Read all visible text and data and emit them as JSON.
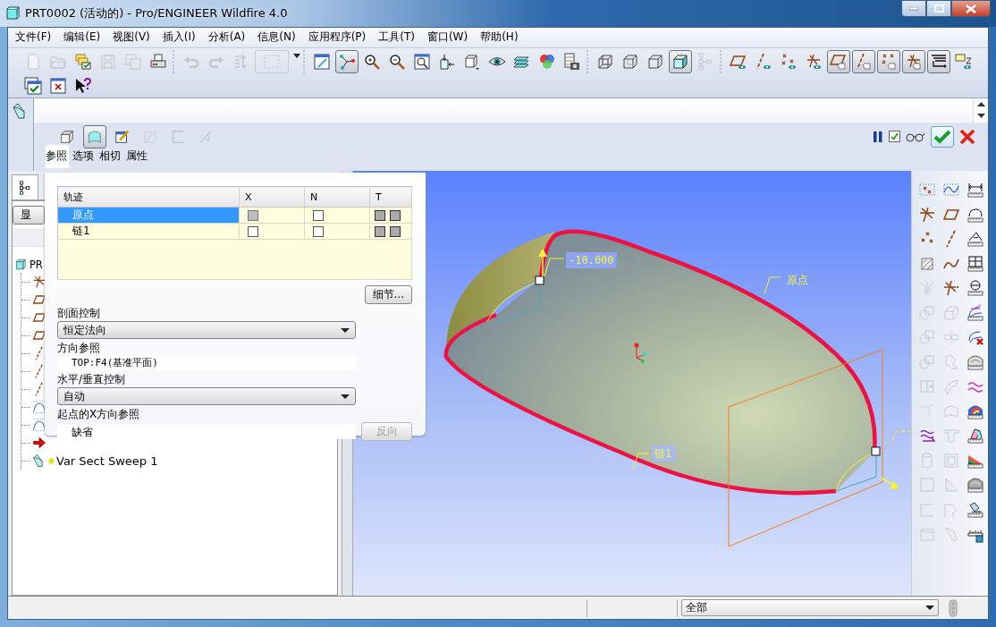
{
  "window": {
    "title": "PRT0002 (活动的) - Pro/ENGINEER Wildfire 4.0"
  },
  "menu": [
    "文件(F)",
    "编辑(E)",
    "视图(V)",
    "插入(I)",
    "分析(A)",
    "信息(N)",
    "应用程序(P)",
    "工具(T)",
    "窗口(W)",
    "帮助(H)"
  ],
  "toolbar_rows": [
    [
      [
        {
          "kind": "new",
          "pressed": false,
          "disabled": true
        },
        {
          "kind": "open",
          "pressed": false,
          "disabled": true
        },
        {
          "kind": "folders",
          "pressed": false,
          "disabled": false
        },
        {
          "kind": "save",
          "pressed": false,
          "disabled": true
        },
        {
          "kind": "savecopy",
          "pressed": false,
          "disabled": true
        },
        {
          "kind": "print",
          "pressed": false,
          "disabled": false
        }
      ],
      [
        {
          "kind": "undo",
          "pressed": false,
          "disabled": true
        },
        {
          "kind": "redo",
          "pressed": false,
          "disabled": true
        },
        {
          "kind": "regen",
          "pressed": false,
          "disabled": true
        },
        {
          "kind": "selectbox",
          "pressed": false,
          "disabled": true
        }
      ],
      [
        {
          "kind": "repaint",
          "pressed": false,
          "disabled": false
        },
        {
          "kind": "spin",
          "pressed": true,
          "disabled": false
        },
        {
          "kind": "zoomin",
          "pressed": false,
          "disabled": false
        },
        {
          "kind": "zoomout",
          "pressed": false,
          "disabled": false
        },
        {
          "kind": "refit",
          "pressed": false,
          "disabled": false
        },
        {
          "kind": "orient",
          "pressed": false,
          "disabled": false
        },
        {
          "kind": "views",
          "pressed": false,
          "disabled": false
        },
        {
          "kind": "display",
          "pressed": false,
          "disabled": false
        },
        {
          "kind": "layers",
          "pressed": false,
          "disabled": false
        },
        {
          "kind": "colors",
          "pressed": false,
          "disabled": false
        },
        {
          "kind": "camera",
          "pressed": false,
          "disabled": false
        }
      ],
      [
        {
          "kind": "wire",
          "pressed": false,
          "disabled": false
        },
        {
          "kind": "hidden",
          "pressed": false,
          "disabled": false
        },
        {
          "kind": "nohidden",
          "pressed": false,
          "disabled": false
        },
        {
          "kind": "shade",
          "pressed": true,
          "disabled": false
        },
        {
          "kind": "tree",
          "pressed": false,
          "disabled": true
        }
      ],
      [
        {
          "kind": "plane-eye",
          "pressed": false,
          "disabled": false
        },
        {
          "kind": "axis-eye",
          "pressed": false,
          "disabled": false
        },
        {
          "kind": "points-eye",
          "pressed": false,
          "disabled": false
        },
        {
          "kind": "csys-eye",
          "pressed": false,
          "disabled": false
        },
        {
          "kind": "plane-tag",
          "pressed": true,
          "disabled": false
        },
        {
          "kind": "axis-tag",
          "pressed": true,
          "disabled": false
        },
        {
          "kind": "points-tag",
          "pressed": true,
          "disabled": false
        },
        {
          "kind": "csys-tag",
          "pressed": true,
          "disabled": false
        },
        {
          "kind": "annotation",
          "pressed": true,
          "disabled": false
        },
        {
          "kind": "spin-eye",
          "pressed": false,
          "disabled": false
        }
      ]
    ],
    [
      [
        {
          "kind": "winok",
          "pressed": false,
          "disabled": false
        },
        {
          "kind": "winx",
          "pressed": false,
          "disabled": false
        },
        {
          "kind": "whatsthis",
          "pressed": false,
          "disabled": false
        }
      ]
    ]
  ],
  "dashboard": {
    "feature_types": [
      {
        "kind": "solid",
        "pressed": false,
        "disabled": false
      },
      {
        "kind": "surface",
        "pressed": true,
        "disabled": false
      },
      {
        "kind": "sketch",
        "pressed": false,
        "disabled": false
      },
      {
        "kind": "remove",
        "pressed": false,
        "disabled": true
      },
      {
        "kind": "thicken",
        "pressed": false,
        "disabled": true
      },
      {
        "kind": "diag",
        "pressed": false,
        "disabled": true
      }
    ],
    "preview": {
      "checked": true
    },
    "tabs": [
      {
        "label": "参照",
        "selected": true
      },
      {
        "label": "选项",
        "selected": false
      },
      {
        "label": "相切",
        "selected": false
      },
      {
        "label": "属性",
        "selected": false
      }
    ]
  },
  "references_panel": {
    "columns": [
      "轨迹",
      "X",
      "N",
      "T"
    ],
    "rows": [
      {
        "name": "原点",
        "selected": true,
        "x": {
          "checked": false,
          "disabled": true
        },
        "n": {
          "checked": false,
          "disabled": false
        }
      },
      {
        "name": "链1",
        "selected": false,
        "x": {
          "checked": false,
          "disabled": false
        },
        "n": {
          "checked": false,
          "disabled": false
        }
      }
    ],
    "details_button": "细节...",
    "section_control": {
      "label": "剖面控制",
      "value": "恒定法向"
    },
    "direction_reference": {
      "label": "方向参照",
      "value": "TOP:F4(基准平面)"
    },
    "hv_control": {
      "label": "水平/垂直控制",
      "value": "自动"
    },
    "x_direction_reference": {
      "label": "起点的X方向参照",
      "value": "缺省",
      "flip_button": {
        "label": "反向",
        "disabled": true
      }
    }
  },
  "model_tree": {
    "tabs": [
      {
        "kind": "tree",
        "selected": true
      }
    ],
    "show_button": "显",
    "root": {
      "label": "PR",
      "children": [
        {
          "kind": "csys"
        },
        {
          "kind": "plane"
        },
        {
          "kind": "plane"
        },
        {
          "kind": "plane"
        },
        {
          "kind": "axis"
        },
        {
          "kind": "axis"
        },
        {
          "kind": "axis"
        },
        {
          "kind": "curve"
        },
        {
          "kind": "curve"
        },
        {
          "kind": "insert"
        },
        {
          "kind": "sweep",
          "label": "Var Sect Sweep 1"
        }
      ]
    }
  },
  "graphics": {
    "labels": [
      {
        "kind": "dimension",
        "text": "-10.000"
      },
      {
        "kind": "tag",
        "text": "原点"
      },
      {
        "kind": "chain",
        "text": "链1"
      }
    ]
  },
  "right_toolbar": [
    {
      "kind": "pgrid",
      "disabled": false
    },
    {
      "kind": "cgrid",
      "disabled": false
    },
    {
      "kind": "mdist",
      "disabled": false
    },
    {
      "kind": "csys",
      "disabled": false
    },
    {
      "kind": "plane",
      "disabled": false
    },
    {
      "kind": "mlen",
      "disabled": false
    },
    {
      "kind": "points",
      "disabled": false
    },
    {
      "kind": "axis",
      "disabled": false
    },
    {
      "kind": "mang",
      "disabled": false
    },
    {
      "kind": "hatch",
      "disabled": false
    },
    {
      "kind": "curve",
      "disabled": false
    },
    {
      "kind": "marea",
      "disabled": false
    },
    {
      "kind": "mirror",
      "disabled": true
    },
    {
      "kind": "csys2",
      "disabled": false
    },
    {
      "kind": "mdia",
      "disabled": false
    },
    {
      "kind": "overlap",
      "disabled": true
    },
    {
      "kind": "box",
      "disabled": true
    },
    {
      "kind": "curv",
      "disabled": false
    },
    {
      "kind": "overlap",
      "disabled": true
    },
    {
      "kind": "revolve",
      "disabled": true
    },
    {
      "kind": "curvx",
      "disabled": false
    },
    {
      "kind": "overlap",
      "disabled": true
    },
    {
      "kind": "sweep",
      "disabled": true
    },
    {
      "kind": "surfruler",
      "disabled": false
    },
    {
      "kind": "extend",
      "disabled": true
    },
    {
      "kind": "patch",
      "disabled": true
    },
    {
      "kind": "wave",
      "disabled": false
    },
    {
      "kind": "corner",
      "disabled": true
    },
    {
      "kind": "patch2",
      "disabled": true
    },
    {
      "kind": "colormap",
      "disabled": false
    },
    {
      "kind": "waveplane",
      "disabled": false
    },
    {
      "kind": "tshape",
      "disabled": true
    },
    {
      "kind": "prism",
      "disabled": false
    },
    {
      "kind": "cyl",
      "disabled": true
    },
    {
      "kind": "shell",
      "disabled": true
    },
    {
      "kind": "colormap2",
      "disabled": false
    },
    {
      "kind": "dotgrid",
      "disabled": true
    },
    {
      "kind": "tri",
      "disabled": true
    },
    {
      "kind": "surfruler2",
      "disabled": false
    },
    {
      "kind": "rect",
      "disabled": true
    },
    {
      "kind": "round",
      "disabled": true
    },
    {
      "kind": "shadow",
      "disabled": false
    },
    {
      "kind": "boxtop",
      "disabled": true
    },
    {
      "kind": "chamfer",
      "disabled": true
    },
    {
      "kind": "rulersave",
      "disabled": false
    }
  ],
  "status_bar": {
    "filter": "全部"
  }
}
